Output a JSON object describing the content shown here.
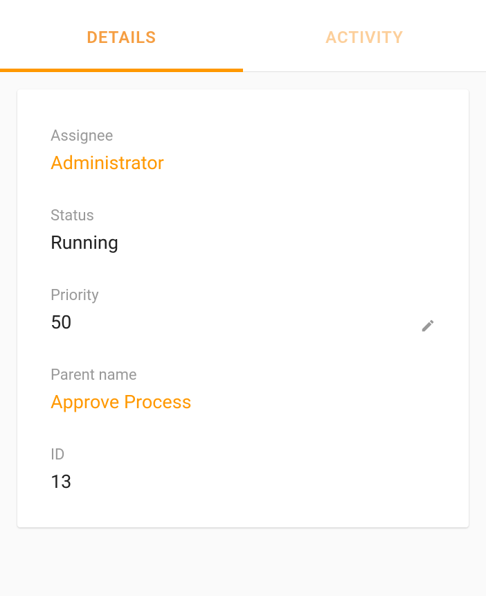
{
  "tabs": {
    "details": "DETAILS",
    "activity": "ACTIVITY"
  },
  "fields": {
    "assignee": {
      "label": "Assignee",
      "value": "Administrator"
    },
    "status": {
      "label": "Status",
      "value": "Running"
    },
    "priority": {
      "label": "Priority",
      "value": "50"
    },
    "parent_name": {
      "label": "Parent name",
      "value": "Approve Process"
    },
    "id": {
      "label": "ID",
      "value": "13"
    }
  }
}
